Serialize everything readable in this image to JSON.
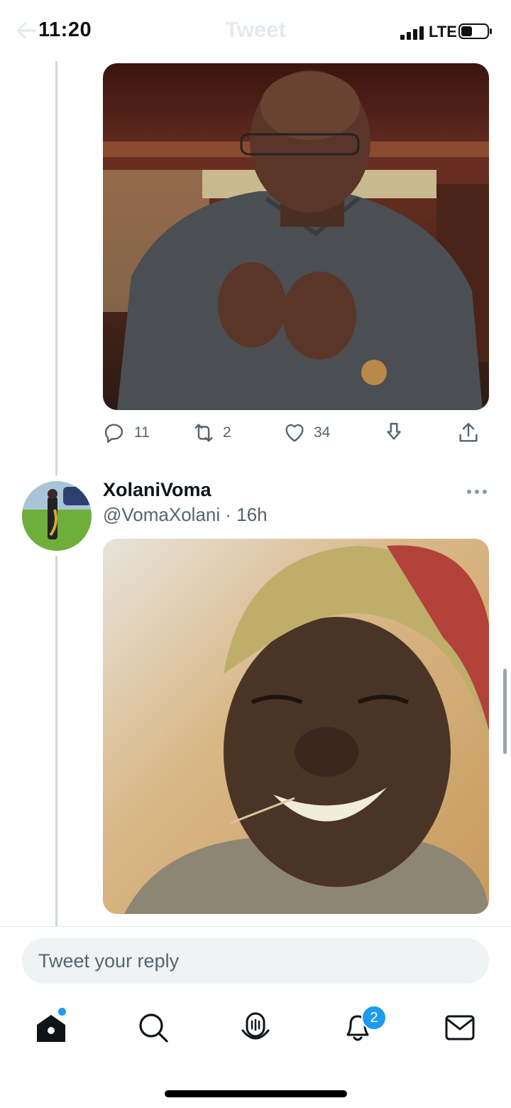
{
  "status_bar": {
    "time": "11:20",
    "network": "LTE"
  },
  "header": {
    "title": "Tweet"
  },
  "tweet_1": {
    "image_icon": "photo-man-gesturing",
    "actions": {
      "reply_count": "11",
      "retweet_count": "2",
      "like_count": "34"
    }
  },
  "tweet_2": {
    "author_name": "XolaniVoma",
    "meta": "@VomaXolani · 16h",
    "avatar_icon": "avatar-saxophone-player",
    "image_icon": "photo-smiling-woman"
  },
  "reply": {
    "placeholder": "Tweet your reply"
  },
  "tab_bar": {
    "notifications_badge": "2"
  },
  "colors": {
    "accent": "#1d9bf0",
    "secondary_text": "#536471",
    "thread_line": "#cfd9de",
    "reply_bg": "#eff3f4"
  }
}
